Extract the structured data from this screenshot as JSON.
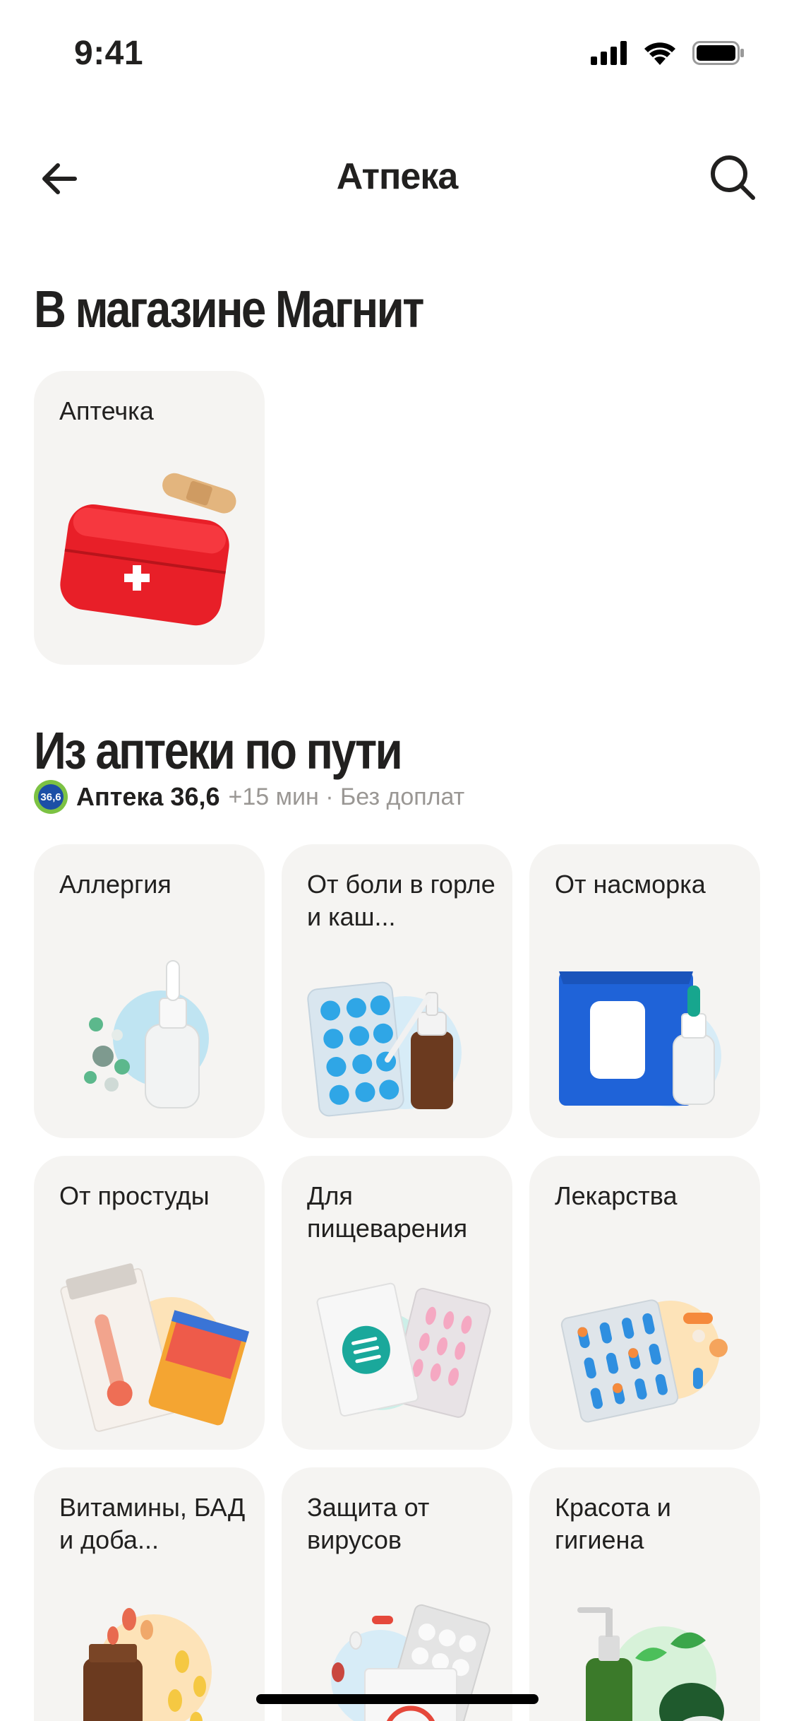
{
  "status_bar": {
    "time": "9:41"
  },
  "nav": {
    "title": "Атпека"
  },
  "store_section": {
    "title": "В магазине Магнит",
    "cards": [
      {
        "label": "Аптечка",
        "icon": "first-aid-kit-icon"
      }
    ]
  },
  "pharmacy_section": {
    "title": "Из аптеки по пути",
    "pharmacy": {
      "logo_text": "36,6",
      "name": "Аптека 36,6",
      "meta": "+15 мин · Без доплат"
    },
    "cards": [
      {
        "label": "Аллергия",
        "icon": "nasal-spray-pills-icon"
      },
      {
        "label": "От боли в горле и каш...",
        "icon": "lozenges-throat-spray-icon"
      },
      {
        "label": "От насморка",
        "icon": "wipes-nasal-spray-icon"
      },
      {
        "label": "От простуды",
        "icon": "thermometer-box-icon"
      },
      {
        "label": "Для пищеварения",
        "icon": "digestion-box-icon"
      },
      {
        "label": "Лекарства",
        "icon": "capsules-blister-icon"
      },
      {
        "label": "Витамины, БАД и доба...",
        "icon": "vitamin-bottle-icon"
      },
      {
        "label": "Защита от вирусов",
        "icon": "virus-protection-icon"
      },
      {
        "label": "Красота и гигиена",
        "icon": "cosmetics-bottle-icon"
      }
    ]
  },
  "colors": {
    "card_bg": "#f5f4f2",
    "text": "#21201f",
    "muted": "#9a9794"
  }
}
